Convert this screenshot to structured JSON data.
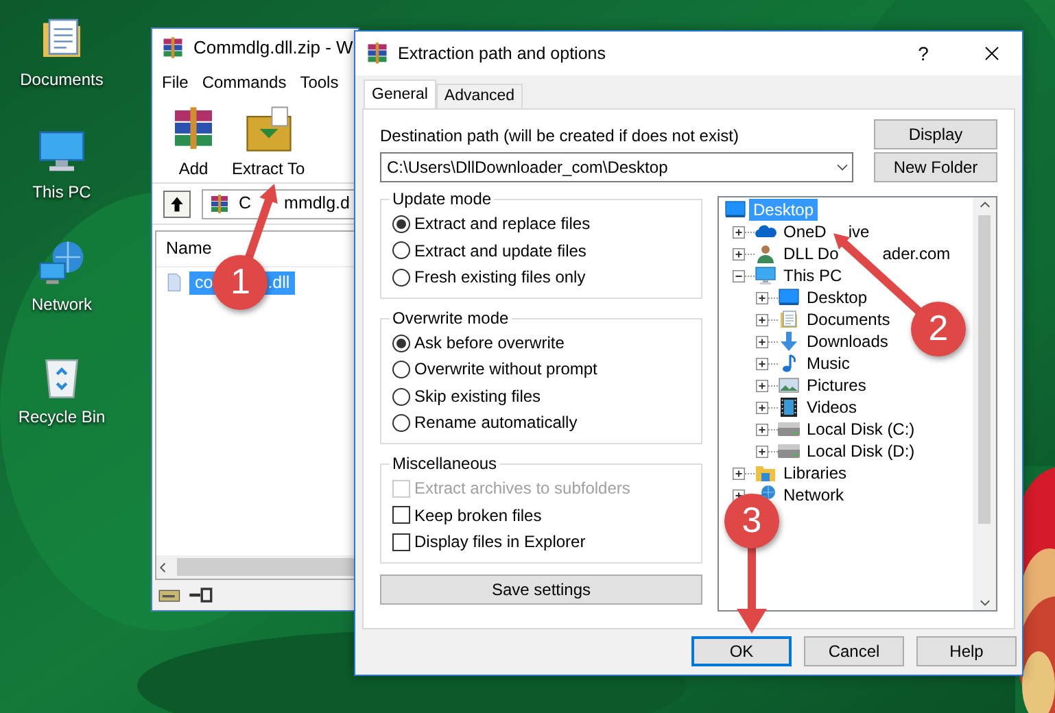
{
  "desktop_icons": [
    {
      "label": "Documents",
      "kind": "documents"
    },
    {
      "label": "This PC",
      "kind": "computer"
    },
    {
      "label": "Network",
      "kind": "network"
    },
    {
      "label": "Recycle Bin",
      "kind": "recycle"
    }
  ],
  "archive_window": {
    "title": "Commdlg.dll.zip - W",
    "menu": [
      "File",
      "Commands",
      "Tools"
    ],
    "toolbar": [
      {
        "label": "Add",
        "kind": "add"
      },
      {
        "label": "Extract To",
        "kind": "extract"
      }
    ],
    "path": [
      "C",
      "mmdlg.d"
    ],
    "columns": [
      "Name"
    ],
    "files": [
      {
        "name": [
          "co",
          ".dll"
        ],
        "selected": true
      }
    ]
  },
  "dialog": {
    "title": "Extraction path and options",
    "help": "?",
    "tabs": [
      {
        "label": "General",
        "selected": true
      },
      {
        "label": "Advanced",
        "selected": false
      }
    ],
    "destination": {
      "label": "Destination path (will be created if does not exist)",
      "value": "C:\\Users\\DllDownloader_com\\Desktop"
    },
    "side_buttons": [
      "Display",
      "New Folder"
    ],
    "groups": [
      {
        "title": "Update mode",
        "options": [
          {
            "kind": "radio",
            "label": "Extract and replace files",
            "selected": true
          },
          {
            "kind": "radio",
            "label": "Extract and update files",
            "selected": false
          },
          {
            "kind": "radio",
            "label": "Fresh existing files only",
            "selected": false
          }
        ]
      },
      {
        "title": "Overwrite mode",
        "options": [
          {
            "kind": "radio",
            "label": "Ask before overwrite",
            "selected": true
          },
          {
            "kind": "radio",
            "label": "Overwrite without prompt",
            "selected": false
          },
          {
            "kind": "radio",
            "label": "Skip existing files",
            "selected": false
          },
          {
            "kind": "radio",
            "label": "Rename automatically",
            "selected": false
          }
        ]
      },
      {
        "title": "Miscellaneous",
        "options": [
          {
            "kind": "checkbox",
            "label": "Extract archives to subfolders",
            "checked": false,
            "disabled": true
          },
          {
            "kind": "checkbox",
            "label": "Keep broken files",
            "checked": false,
            "disabled": false
          },
          {
            "kind": "checkbox",
            "label": "Display files in Explorer",
            "checked": false,
            "disabled": false
          }
        ]
      }
    ],
    "save_button": "Save settings",
    "tree": [
      {
        "label": "Desktop",
        "kind": "desktop",
        "selected": true,
        "children": [
          {
            "label": [
              "OneD",
              "ive"
            ],
            "kind": "onedrive",
            "selected": false,
            "expanded": false
          },
          {
            "label": [
              "DLL Do",
              "ader.com"
            ],
            "kind": "user",
            "selected": false,
            "expanded": false
          },
          {
            "label": "This PC",
            "kind": "computer",
            "selected": false,
            "expanded": true,
            "children": [
              {
                "label": "Desktop",
                "kind": "desktop",
                "selected": false,
                "expanded": false
              },
              {
                "label": "Documents",
                "kind": "documents",
                "selected": false,
                "expanded": false
              },
              {
                "label": "Downloads",
                "kind": "downloads",
                "selected": false,
                "expanded": false
              },
              {
                "label": "Music",
                "kind": "music",
                "selected": false,
                "expanded": false
              },
              {
                "label": "Pictures",
                "kind": "pictures",
                "selected": false,
                "expanded": false
              },
              {
                "label": "Videos",
                "kind": "videos",
                "selected": false,
                "expanded": false
              },
              {
                "label": "Local Disk (C:)",
                "kind": "drive",
                "selected": false,
                "expanded": false
              },
              {
                "label": "Local Disk (D:)",
                "kind": "drive",
                "selected": false,
                "expanded": false
              }
            ]
          },
          {
            "label": "Libraries",
            "kind": "libraries",
            "selected": false,
            "expanded": false
          },
          {
            "label": "Network",
            "kind": "network",
            "selected": false,
            "expanded": false
          }
        ]
      }
    ],
    "buttons": [
      {
        "label": "OK",
        "default": true
      },
      {
        "label": "Cancel",
        "default": false
      },
      {
        "label": "Help",
        "default": false
      }
    ]
  },
  "annotations": [
    {
      "number": "1"
    },
    {
      "number": "2"
    },
    {
      "number": "3"
    }
  ]
}
